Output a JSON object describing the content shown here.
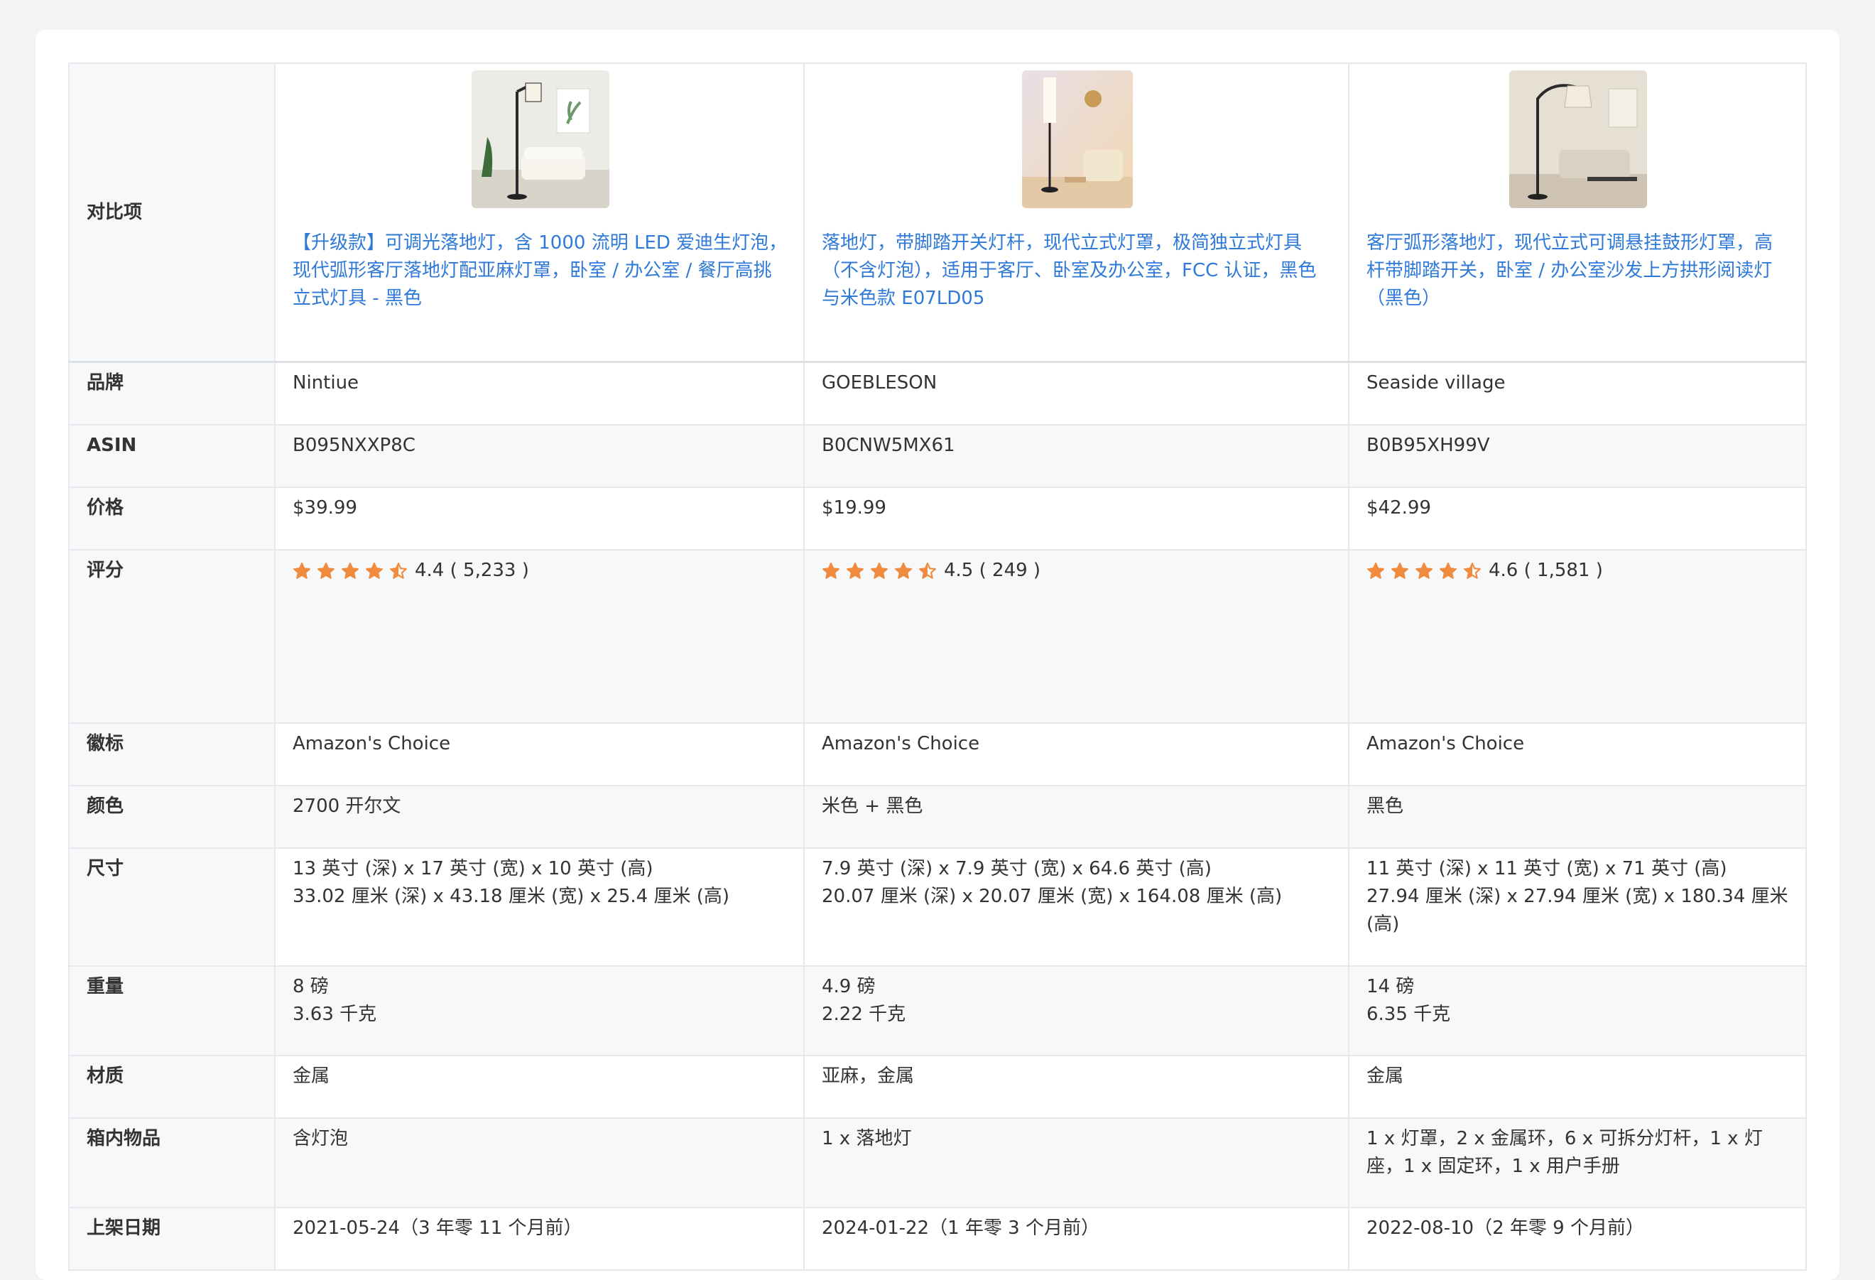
{
  "row_labels": {
    "compare": "对比项",
    "brand": "品牌",
    "asin": "ASIN",
    "price": "价格",
    "rating": "评分",
    "badge": "徽标",
    "color": "颜色",
    "dimensions": "尺寸",
    "weight": "重量",
    "material": "材质",
    "box": "箱内物品",
    "date": "上架日期"
  },
  "products": [
    {
      "title": "【升级款】可调光落地灯，含 1000 流明 LED 爱迪生灯泡，现代弧形客厅落地灯配亚麻灯罩，卧室 / 办公室 / 餐厅高挑立式灯具 - 黑色",
      "brand": "Nintiue",
      "asin": "B095NXXP8C",
      "price": "$39.99",
      "rating_value": 4.4,
      "rating_text": "4.4 ( 5,233 )",
      "badge": "Amazon's Choice",
      "color": "2700 开尔文",
      "dim_in": "13 英寸 (深) x 17 英寸 (宽) x 10 英寸 (高)",
      "dim_cm": "33.02 厘米 (深) x 43.18 厘米 (宽) x 25.4 厘米 (高)",
      "weight_lb": "8 磅",
      "weight_kg": "3.63 千克",
      "material": "金属",
      "box": "含灯泡",
      "date": "2021-05-24（3 年零 11 个月前）"
    },
    {
      "title": "落地灯，带脚踏开关灯杆，现代立式灯罩，极简独立式灯具（不含灯泡），适用于客厅、卧室及办公室，FCC 认证，黑色与米色款 E07LD05",
      "brand": "GOEBLESON",
      "asin": "B0CNW5MX61",
      "price": "$19.99",
      "rating_value": 4.5,
      "rating_text": "4.5 ( 249 )",
      "badge": "Amazon's Choice",
      "color": "米色 + 黑色",
      "dim_in": "7.9 英寸 (深) x 7.9 英寸 (宽) x 64.6 英寸 (高)",
      "dim_cm": "20.07 厘米 (深) x 20.07 厘米 (宽) x 164.08 厘米 (高)",
      "weight_lb": "4.9 磅",
      "weight_kg": "2.22 千克",
      "material": "亚麻，金属",
      "box": "1 x 落地灯",
      "date": "2024-01-22（1 年零 3 个月前）"
    },
    {
      "title": "客厅弧形落地灯，现代立式可调悬挂鼓形灯罩，高杆带脚踏开关，卧室 / 办公室沙发上方拱形阅读灯（黑色）",
      "brand": "Seaside village",
      "asin": "B0B95XH99V",
      "price": "$42.99",
      "rating_value": 4.6,
      "rating_text": "4.6 ( 1,581 )",
      "badge": "Amazon's Choice",
      "color": "黑色",
      "dim_in": "11 英寸 (深) x 11 英寸 (宽) x 71 英寸 (高)",
      "dim_cm": "27.94 厘米 (深) x 27.94 厘米 (宽) x 180.34 厘米 (高)",
      "weight_lb": "14 磅",
      "weight_kg": "6.35 千克",
      "material": "金属",
      "box": "1 x 灯罩，2 x 金属环，6 x 可拆分灯杆，1 x 灯座，1 x 固定环，1 x 用户手册",
      "date": "2022-08-10（2 年零 9 个月前）"
    }
  ],
  "colors": {
    "link": "#2f7ad8",
    "star": "#f08a3c",
    "label_bg": "#f7f8fa",
    "border": "#e6e8eb"
  }
}
